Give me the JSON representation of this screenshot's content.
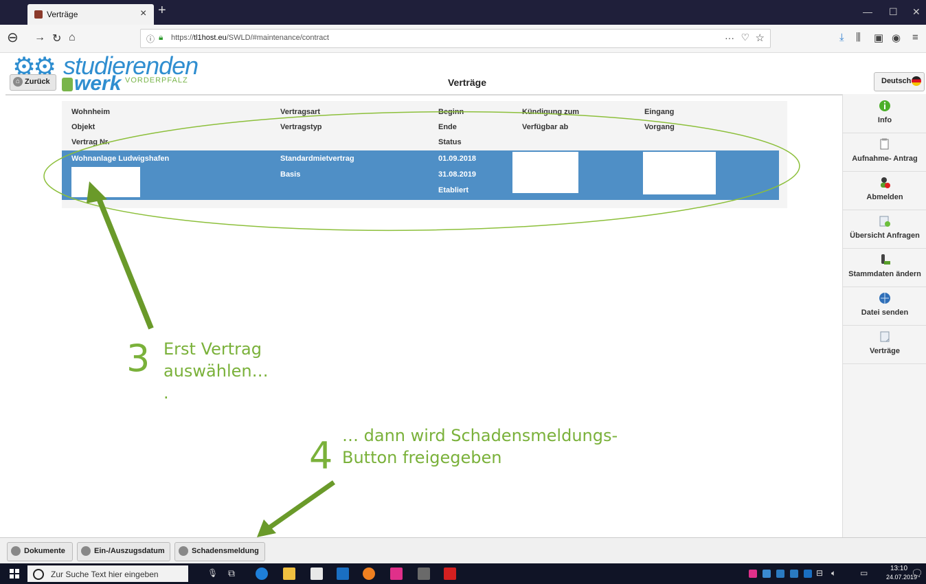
{
  "browser": {
    "tab_title": "Verträge",
    "url_prefix": "https://",
    "url_host": "tl1host.eu",
    "url_path": "/SWLD/#maintenance/contract"
  },
  "header": {
    "logo_line1": "studierenden",
    "logo_line2": "werk",
    "logo_line3": "VORDERPFALZ",
    "back_label": "Zurück",
    "title": "Verträge",
    "language_label": "Deutsch"
  },
  "grid": {
    "headers": [
      [
        "Wohnheim",
        "Vertragsart",
        "Beginn",
        "Kündigung zum",
        "Eingang"
      ],
      [
        "Objekt",
        "Vertragstyp",
        "Ende",
        "Verfügbar ab",
        "Vorgang"
      ],
      [
        "Vertrag Nr.",
        "",
        "Status",
        "",
        ""
      ]
    ],
    "row": {
      "wohnheim": "Wohnanlage Ludwigshafen",
      "vertragsart": "Standardmietvertrag",
      "vertragstyp": "Basis",
      "beginn": "01.09.2018",
      "ende": "31.08.2019",
      "status": "Etabliert"
    }
  },
  "sidebar": {
    "items": [
      {
        "label": "Info",
        "icon": "info-icon"
      },
      {
        "label": "Aufnahme- Antrag",
        "icon": "document-icon"
      },
      {
        "label": "Abmelden",
        "icon": "user-remove-icon"
      },
      {
        "label": "Übersicht Anfragen",
        "icon": "overview-icon"
      },
      {
        "label": "Stammdaten ändern",
        "icon": "edit-icon"
      },
      {
        "label": "Datei senden",
        "icon": "globe-send-icon"
      },
      {
        "label": "Verträge",
        "icon": "contract-icon"
      }
    ]
  },
  "annotations": {
    "step3_number": "3",
    "step3_line1": "Erst Vertrag",
    "step3_line2": "auswählen…",
    "step3_line3": ".",
    "step4_number": "4",
    "step4_line1": "… dann wird Schadensmeldungs-",
    "step4_line2": "Button freigegeben",
    "color": "#7ab13a"
  },
  "bottom": {
    "buttons": [
      "Dokumente",
      "Ein-/Auszugsdatum",
      "Schadensmeldung"
    ]
  },
  "taskbar": {
    "search_placeholder": "Zur Suche Text hier eingeben",
    "time": "13:10",
    "date": "24.07.2019"
  },
  "colors": {
    "selected_row": "#4f8fc6",
    "brand_blue": "#2f8ed0",
    "brand_green": "#79b54b"
  }
}
